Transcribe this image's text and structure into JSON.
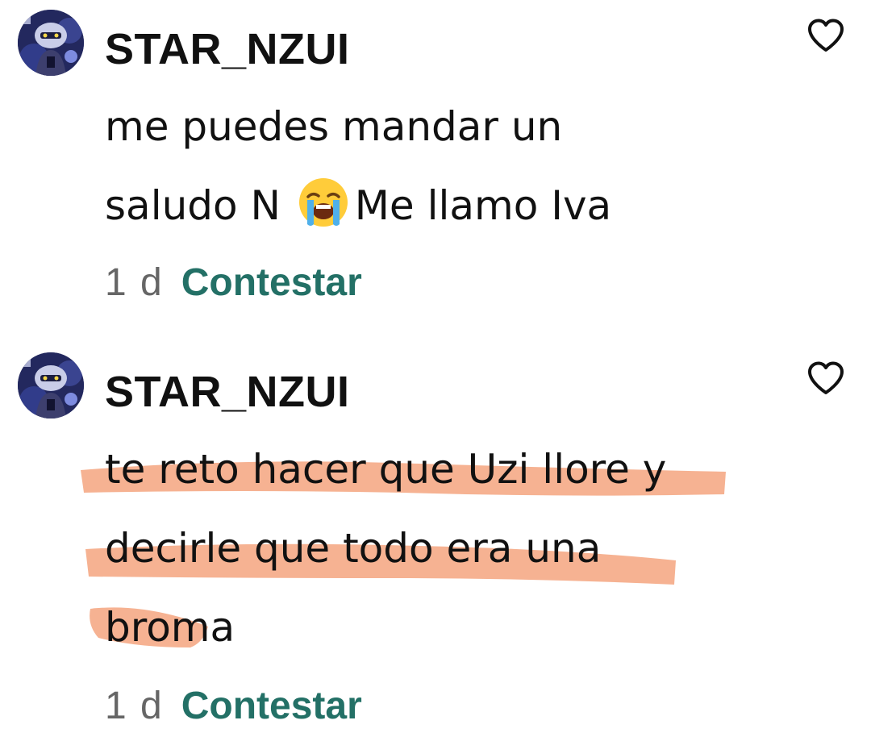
{
  "comments": [
    {
      "username": "STAR_NZUI",
      "avatar_icon": "robot-avatar-icon",
      "lines": [
        {
          "before": "me puedes mandar un",
          "emoji": "",
          "after": ""
        },
        {
          "before": "saludo N ",
          "emoji": "loudly-crying-face-emoji",
          "after": "Me llamo Iva"
        }
      ],
      "timestamp": "1 d",
      "reply_label": "Contestar",
      "like_icon": "heart-outline-icon"
    },
    {
      "username": "STAR_NZUI",
      "avatar_icon": "robot-avatar-icon",
      "lines": [
        {
          "before": "te reto hacer que Uzi llore y",
          "emoji": "",
          "after": ""
        },
        {
          "before": "decirle que todo era una",
          "emoji": "",
          "after": ""
        },
        {
          "before": "broma",
          "emoji": "",
          "after": ""
        }
      ],
      "timestamp": "1 d",
      "reply_label": "Contestar",
      "like_icon": "heart-outline-icon"
    }
  ],
  "colors": {
    "reply_link": "#237066",
    "timestamp": "#666666",
    "highlight_marker": "#f4a47f"
  }
}
